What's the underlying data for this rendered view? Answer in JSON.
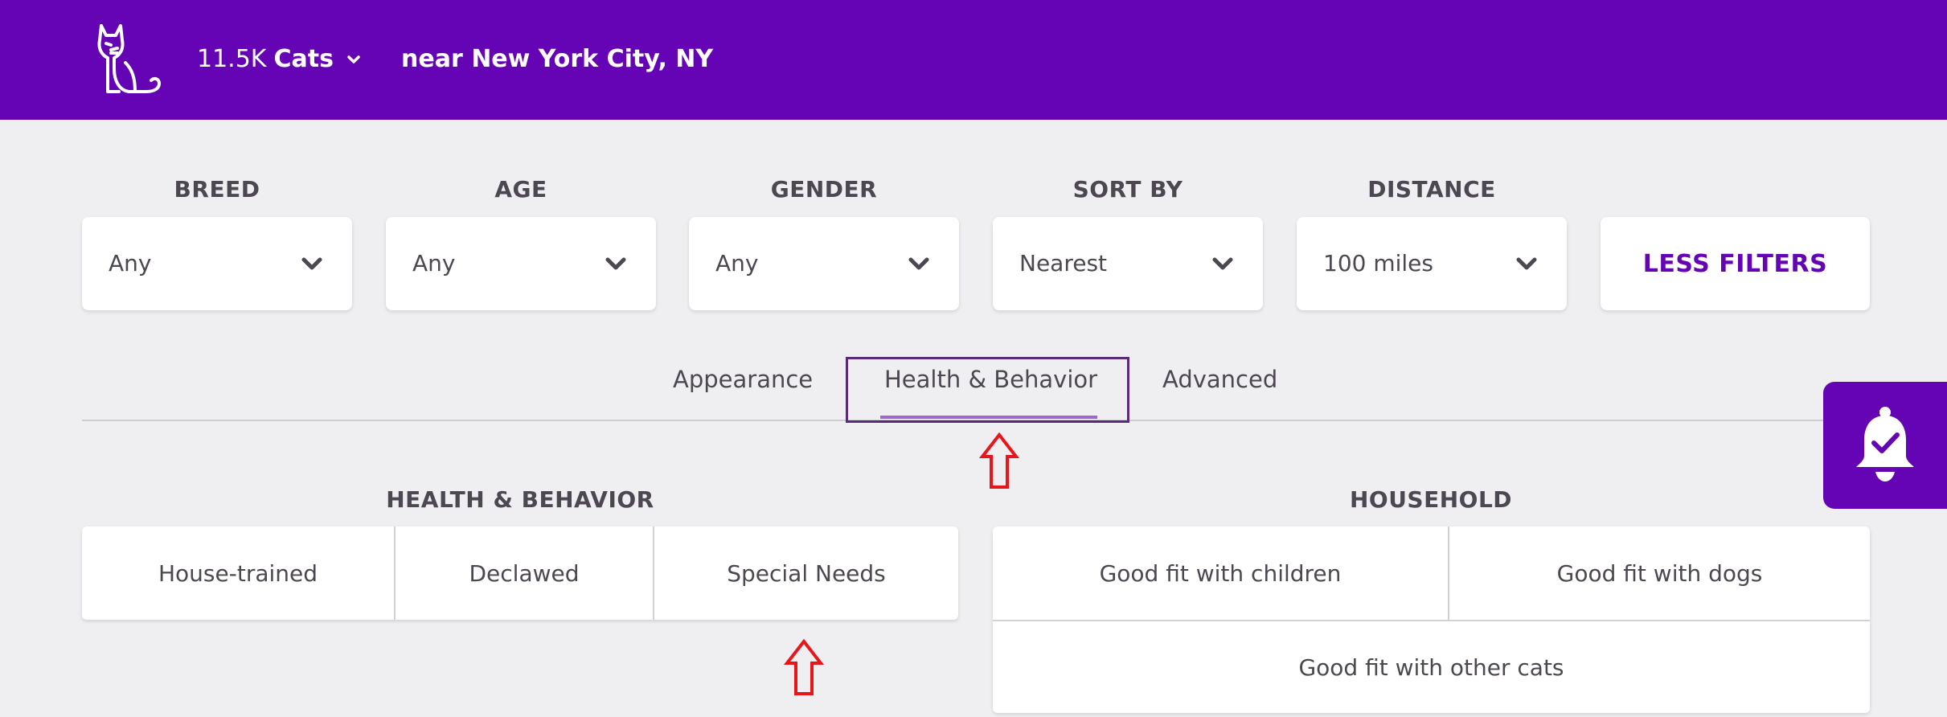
{
  "header": {
    "result_count": "11.5K",
    "animal_type": "Cats",
    "location": "near New York City, NY",
    "icons": [
      "cat-logo-icon",
      "chevron-down-icon"
    ],
    "background_color": "#6504b5"
  },
  "filters": [
    {
      "label": "BREED",
      "value": "Any"
    },
    {
      "label": "AGE",
      "value": "Any"
    },
    {
      "label": "GENDER",
      "value": "Any"
    },
    {
      "label": "SORT BY",
      "value": "Nearest"
    },
    {
      "label": "DISTANCE",
      "value": "100 miles"
    }
  ],
  "less_filters_label": "LESS FILTERS",
  "tabs": [
    {
      "label": "Appearance",
      "active": false
    },
    {
      "label": "Health & Behavior",
      "active": true
    },
    {
      "label": "Advanced",
      "active": false
    }
  ],
  "health_behavior": {
    "title": "HEALTH & BEHAVIOR",
    "options": [
      "House-trained",
      "Declawed",
      "Special Needs"
    ]
  },
  "household": {
    "title": "HOUSEHOLD",
    "options": [
      "Good fit with children",
      "Good fit with dogs",
      "Good fit with other cats"
    ]
  },
  "alert_button": {
    "icon": "bell-check-icon"
  },
  "annotations": {
    "arrow_color": "#e8151b",
    "icon": "red-up-arrow-icon"
  },
  "accent_color": "#6504b5"
}
